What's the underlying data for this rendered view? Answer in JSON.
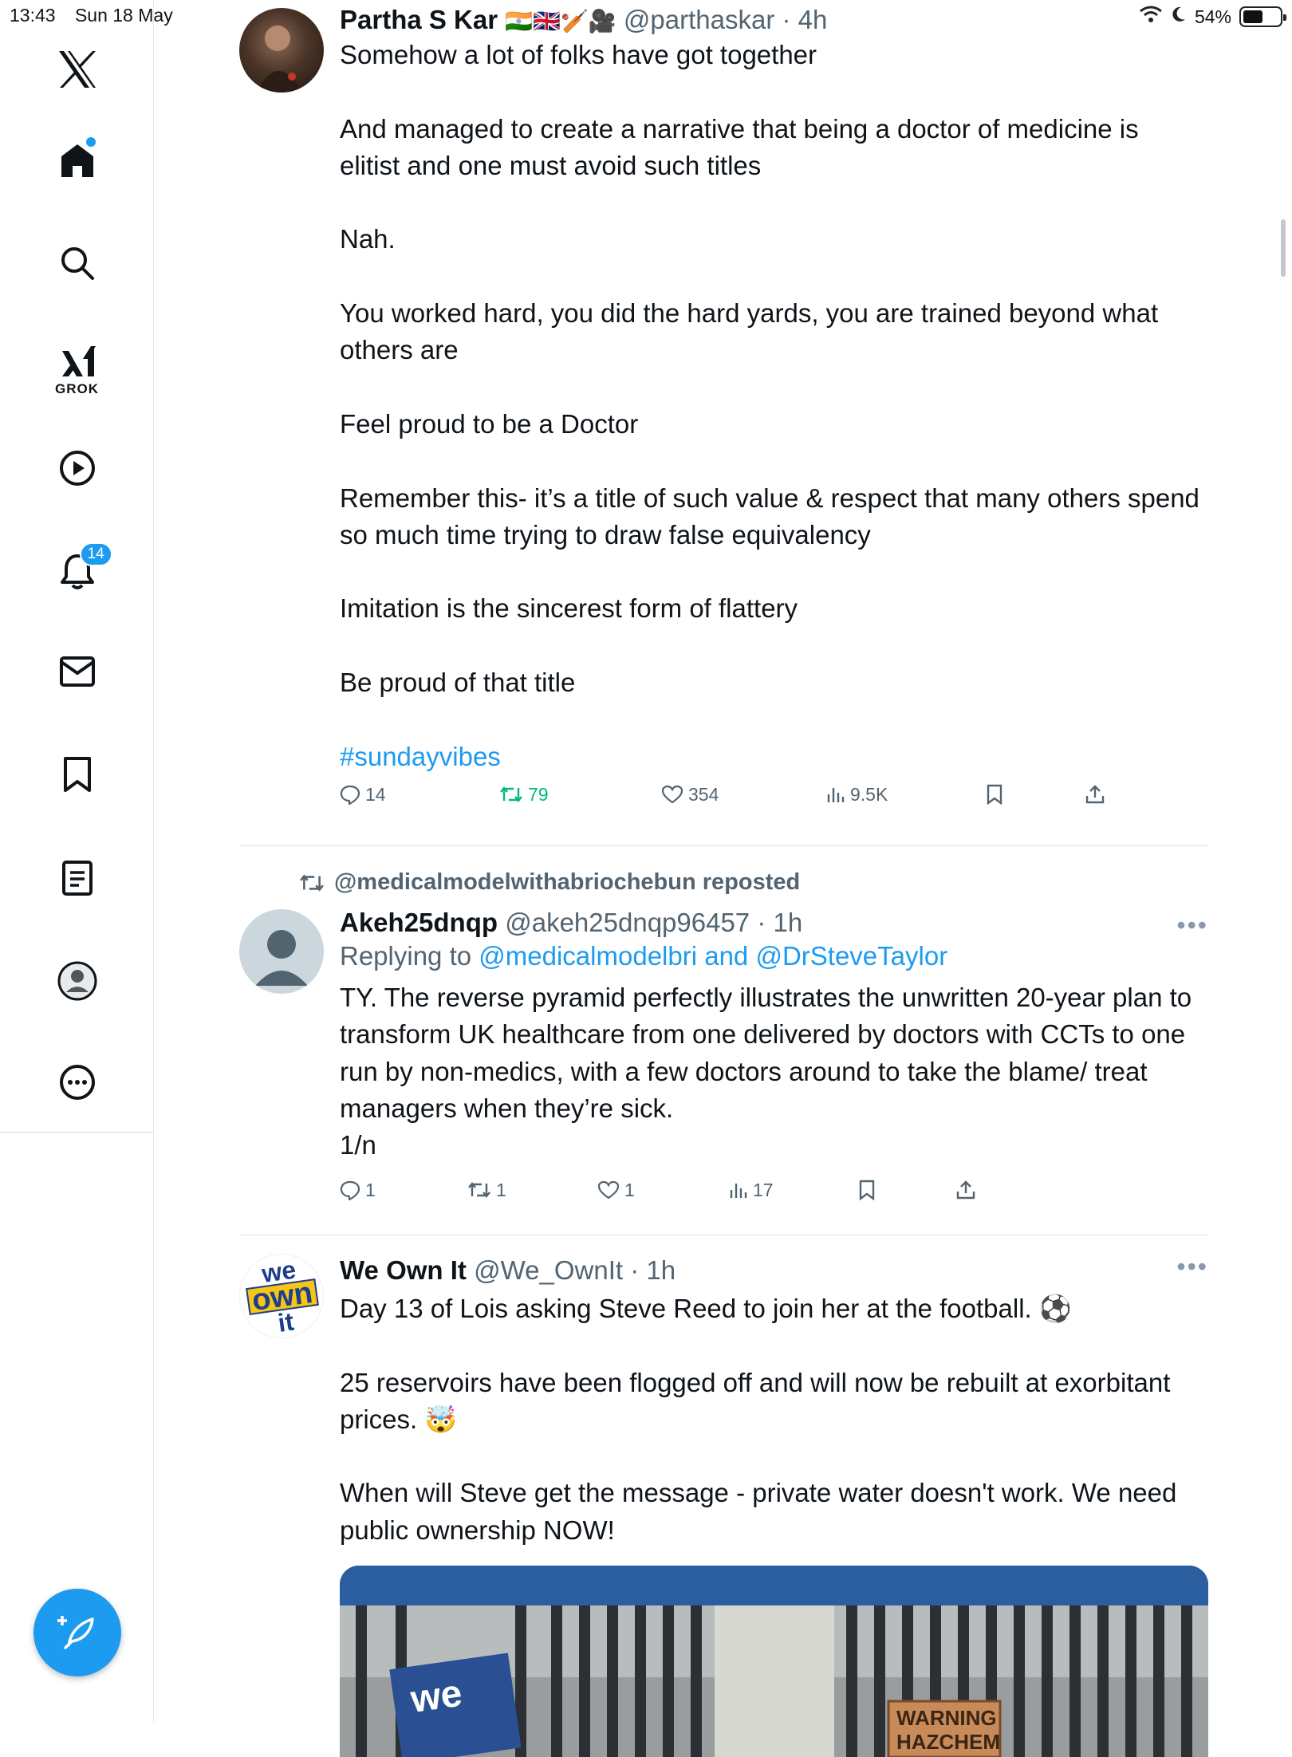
{
  "status_bar": {
    "time": "13:43",
    "date": "Sun 18 May",
    "battery": "54%",
    "battery_level": 0.54
  },
  "sidebar": {
    "items": [
      {
        "name": "x-logo-icon"
      },
      {
        "name": "home-icon"
      },
      {
        "name": "search-icon"
      },
      {
        "name": "grok-icon",
        "label": "GROK"
      },
      {
        "name": "video-play-icon"
      },
      {
        "name": "notifications-bell-icon",
        "badge": "14"
      },
      {
        "name": "messages-envelope-icon"
      },
      {
        "name": "bookmark-icon"
      },
      {
        "name": "lists-icon"
      },
      {
        "name": "profile-icon"
      },
      {
        "name": "more-ellipsis-icon"
      }
    ],
    "compose_icon": "compose-feather-icon"
  },
  "tweets": [
    {
      "name": "Partha S Kar",
      "flags": "🇮🇳🇬🇧🏏🎥",
      "handle": "@parthaskar",
      "time": "4h",
      "text": "Somehow a lot of folks have got together\n\nAnd managed to create a narrative that being a doctor of medicine is elitist and one must avoid such titles\n\nNah.\n\nYou worked hard, you did the hard yards, you are trained beyond what others are\n\nFeel proud to be a Doctor\n\nRemember this- it’s a title of such value & respect that many others spend so much time trying to draw false equivalency\n\nImitation is the sincerest form of flattery\n\nBe proud of that title\n\n",
      "hashtag": "#sundayvibes",
      "replies": "14",
      "reposts": "79",
      "likes": "354",
      "views": "9.5K"
    },
    {
      "repost_by": "@medicalmodelwithabriochebun reposted",
      "name": "Akeh25dnqp",
      "handle": "@akeh25dnqp96457",
      "time": "1h",
      "replying_label": "Replying to",
      "reply_to_1": "@medicalmodelbri",
      "reply_and": "and",
      "reply_to_2": "@DrSteveTaylor",
      "text": "TY. The reverse pyramid perfectly illustrates the unwritten 20-year plan to transform UK healthcare from one delivered by doctors with CCTs to one run by non-medics, with a few doctors around to take the blame/ treat managers when they’re sick.\n1/n",
      "replies": "1",
      "reposts": "1",
      "likes": "1",
      "views": "17"
    },
    {
      "name": "We Own It",
      "handle": "@We_OwnIt",
      "time": "1h",
      "avatar_text": [
        "we",
        "own",
        "it"
      ],
      "text": "Day 13 of Lois asking Steve Reed to join her at the football. ⚽\n\n25 reservoirs have been flogged off and will now be rebuilt at exorbitant prices. 🤯\n\nWhen will Steve get the message - private water doesn't work. We need public ownership NOW!",
      "media_text": [
        "we",
        "WARNING",
        "HAZCHEM"
      ]
    }
  ],
  "colors": {
    "accent": "#1d9bf0",
    "repost_green": "#00ba7c",
    "muted": "#536471"
  }
}
